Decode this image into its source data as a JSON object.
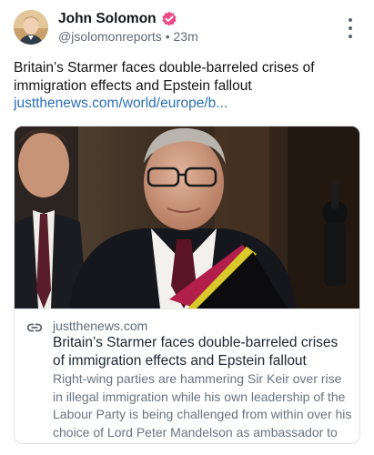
{
  "author": {
    "name": "John Solomon",
    "handle": "@jsolomonreports",
    "separator": "•",
    "timestamp": "23m",
    "verified_badge_icon": "verified-check-icon",
    "badge_color": "#ec4c86"
  },
  "post": {
    "text": "Britain’s Starmer faces double-barreled crises of immigration effects and Epstein fallout",
    "link_text": "justthenews.com/world/europe/b..."
  },
  "link_card": {
    "domain": "justthenews.com",
    "title": "Britain’s Starmer faces double-barreled crises of immigration effects and Epstein fallout",
    "description": "Right-wing parties are hammering Sir Keir over rise in illegal immigration while his own leadership of the Labour Party is being challenged from within over his choice of Lord Peter Mandelson as ambassador to the…",
    "link_icon": "link-chain-icon"
  },
  "actions": {
    "more_icon": "more-vertical-icon"
  },
  "colors": {
    "link": "#2a6fb5",
    "muted": "#5f6b78",
    "text": "#141414"
  }
}
